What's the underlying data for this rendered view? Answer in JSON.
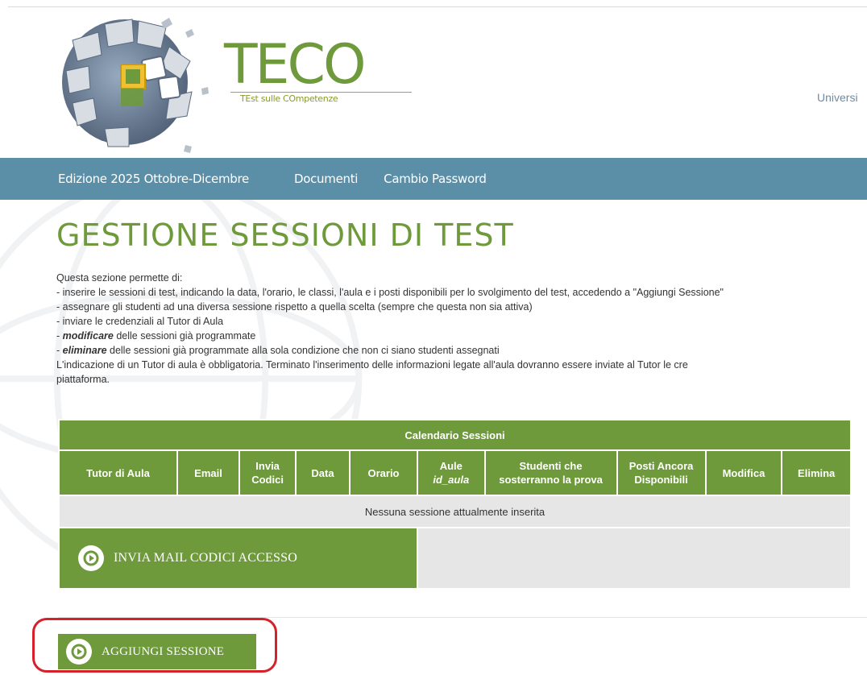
{
  "header": {
    "brand_title": "TECO",
    "brand_subtitle": "TEst sulle COmpetenze",
    "university_label": "Universi"
  },
  "nav": {
    "items": [
      {
        "label": "Edizione 2025 Ottobre-Dicembre"
      },
      {
        "label": "Documenti"
      },
      {
        "label": "Cambio Password"
      }
    ]
  },
  "page": {
    "title": "GESTIONE SESSIONI DI TEST",
    "intro": "Questa sezione permette di:",
    "bullets": [
      {
        "prefix": "- ",
        "emphasis": "",
        "text": "inserire le sessioni di test, indicando la data, l'orario, le classi, l'aula e i posti disponibili per lo svolgimento del test, accedendo a \"Aggiungi Sessione\""
      },
      {
        "prefix": "- ",
        "emphasis": "",
        "text": "assegnare gli studenti ad una diversa sessione rispetto a quella scelta (sempre che questa non sia attiva)"
      },
      {
        "prefix": "- ",
        "emphasis": "",
        "text": "inviare le credenziali al Tutor di Aula"
      },
      {
        "prefix": "- ",
        "emphasis": "modificare",
        "text": " delle sessioni già programmate"
      },
      {
        "prefix": "- ",
        "emphasis": "eliminare",
        "text": " delle sessioni già programmate alla sola condizione che non ci siano studenti assegnati"
      }
    ],
    "note": "L'indicazione di un Tutor di aula è obbligatoria. Terminato l'inserimento delle informazioni legate all'aula dovranno essere inviate al Tutor le cre",
    "note_tail": "piattaforma."
  },
  "table": {
    "caption": "Calendario Sessioni",
    "columns": [
      {
        "label": "Tutor di Aula"
      },
      {
        "label": "Email"
      },
      {
        "label": "Invia Codici"
      },
      {
        "label": "Data"
      },
      {
        "label": "Orario"
      },
      {
        "label": "Aule",
        "sub": "id_aula"
      },
      {
        "label": "Studenti che sosterranno la prova"
      },
      {
        "label": "Posti Ancora Disponibili"
      },
      {
        "label": "Modifica"
      },
      {
        "label": "Elimina"
      }
    ],
    "empty_message": "Nessuna sessione attualmente inserita",
    "send_codes_button": "INVIA MAIL CODICI ACCESSO"
  },
  "actions": {
    "add_session_button": "AGGIUNGI SESSIONE",
    "highlight_color": "#d6202a"
  },
  "colors": {
    "accent_green": "#6e9a3c",
    "nav_blue": "#5b8fa8",
    "row_grey": "#e6e6e6"
  },
  "icons": {
    "play": "play-circle-icon",
    "logo": "globe-logo-icon"
  }
}
